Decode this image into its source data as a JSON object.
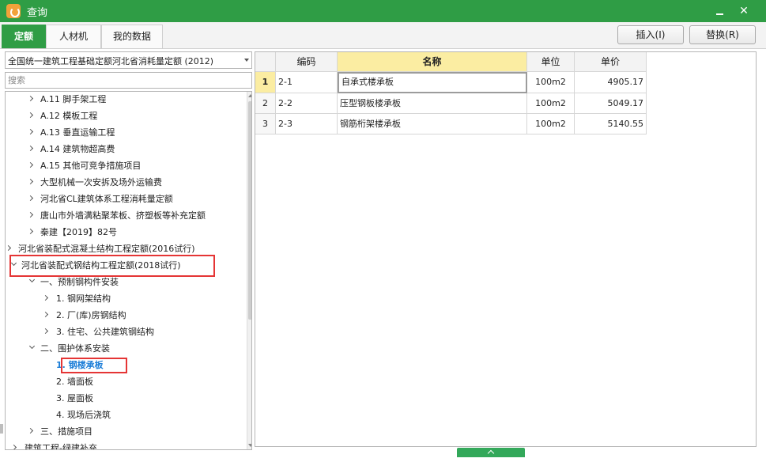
{
  "window": {
    "title": "查询",
    "minimize_glyph": "",
    "close_glyph": "✕"
  },
  "tabs": [
    {
      "label": "定额",
      "active": true
    },
    {
      "label": "人材机",
      "active": false
    },
    {
      "label": "我的数据",
      "active": false
    }
  ],
  "buttons": {
    "insert": "插入(I)",
    "replace": "替换(R)"
  },
  "library": {
    "selected": "全国统一建筑工程基础定额河北省消耗量定额 (2012)"
  },
  "search": {
    "placeholder": "搜索",
    "value": ""
  },
  "tree": [
    {
      "label": "A.11 脚手架工程",
      "state": "collapsed"
    },
    {
      "label": "A.12 模板工程",
      "state": "collapsed"
    },
    {
      "label": "A.13 垂直运输工程",
      "state": "collapsed"
    },
    {
      "label": "A.14 建筑物超高费",
      "state": "collapsed"
    },
    {
      "label": "A.15 其他可竞争措施项目",
      "state": "collapsed"
    },
    {
      "label": "大型机械一次安拆及场外运输费",
      "state": "collapsed"
    },
    {
      "label": "河北省CL建筑体系工程消耗量定额",
      "state": "collapsed"
    },
    {
      "label": "唐山市外墙满粘聚苯板、挤塑板等补充定额",
      "state": "collapsed"
    },
    {
      "label": "秦建【2019】82号",
      "state": "collapsed"
    },
    {
      "label": "河北省装配式混凝土结构工程定额(2016试行)",
      "state": "collapsed"
    },
    {
      "label": "河北省装配式钢结构工程定额(2018试行)",
      "state": "expanded",
      "highlighted": true
    },
    {
      "label": "一、预制钢构件安装",
      "state": "expanded"
    },
    {
      "label": "1. 钢网架结构",
      "state": "collapsed"
    },
    {
      "label": "2. 厂(库)房钢结构",
      "state": "collapsed"
    },
    {
      "label": "3. 住宅、公共建筑钢结构",
      "state": "collapsed"
    },
    {
      "label": "二、围护体系安装",
      "state": "expanded"
    },
    {
      "label": "1. 钢楼承板",
      "state": "leaf",
      "selected": true,
      "highlighted": true
    },
    {
      "label": "2. 墙面板",
      "state": "leaf"
    },
    {
      "label": "3. 屋面板",
      "state": "leaf"
    },
    {
      "label": "4. 现场后浇筑",
      "state": "leaf"
    },
    {
      "label": "三、措施项目",
      "state": "collapsed"
    },
    {
      "label": "建筑工程-绿建补充",
      "state": "collapsed"
    }
  ],
  "grid": {
    "headers": [
      "",
      "编码",
      "名称",
      "单位",
      "单价"
    ],
    "sorted_column": "名称",
    "current_row": 1,
    "rows": [
      {
        "num": "1",
        "code": "2-1",
        "name": "自承式楼承板",
        "unit": "100m2",
        "price": "4905.17"
      },
      {
        "num": "2",
        "code": "2-2",
        "name": "压型钢板楼承板",
        "unit": "100m2",
        "price": "5049.17"
      },
      {
        "num": "3",
        "code": "2-3",
        "name": "钢筋桁架楼承板",
        "unit": "100m2",
        "price": "5140.55"
      }
    ]
  },
  "colors": {
    "titlebar": "#2f9d45",
    "active_tab": "#2f9d45",
    "selected_header": "#fbeda2",
    "selected_text": "#1e7fd8",
    "highlight_box": "#e53535"
  }
}
